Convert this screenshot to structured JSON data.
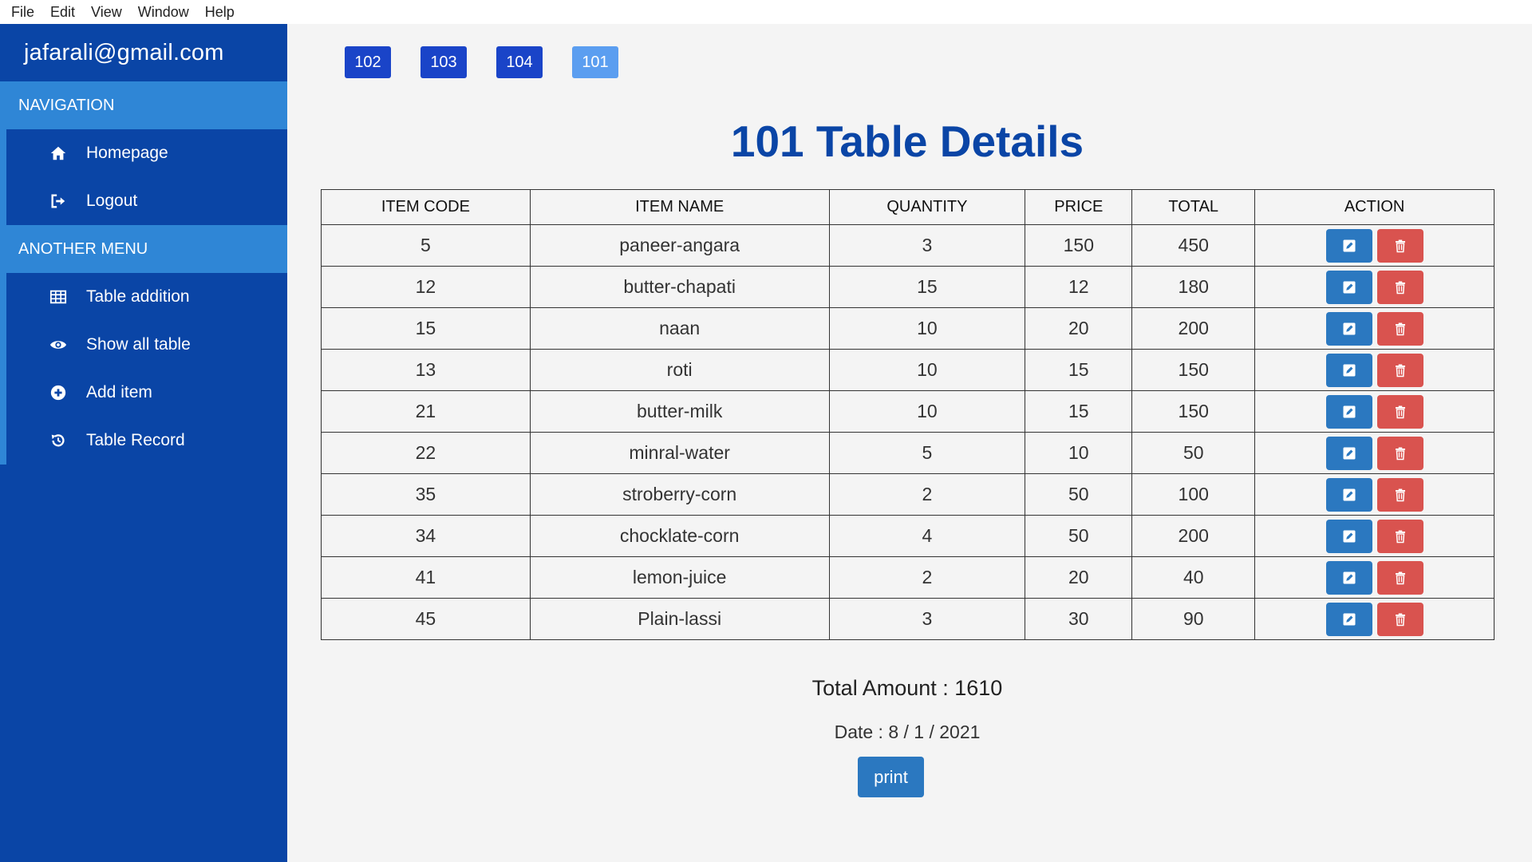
{
  "menubar": {
    "items": [
      "File",
      "Edit",
      "View",
      "Window",
      "Help"
    ]
  },
  "sidebar": {
    "email": "jafarali@gmail.com",
    "navigation": {
      "title": "NAVIGATION",
      "items": [
        {
          "label": "Homepage",
          "icon": "home-icon"
        },
        {
          "label": "Logout",
          "icon": "logout-icon"
        }
      ]
    },
    "another_menu": {
      "title": "ANOTHER MENU",
      "items": [
        {
          "label": "Table addition",
          "icon": "table-icon"
        },
        {
          "label": "Show all table",
          "icon": "eye-icon"
        },
        {
          "label": "Add item",
          "icon": "plus-circle-icon"
        },
        {
          "label": "Table Record",
          "icon": "history-icon"
        }
      ]
    }
  },
  "tabs": [
    "102",
    "103",
    "104",
    "101"
  ],
  "active_tab": "101",
  "title": "101 Table Details",
  "table": {
    "headers": [
      "ITEM CODE",
      "ITEM NAME",
      "QUANTITY",
      "PRICE",
      "TOTAL",
      "ACTION"
    ],
    "rows": [
      [
        "5",
        "paneer-angara",
        "3",
        "150",
        "450"
      ],
      [
        "12",
        "butter-chapati",
        "15",
        "12",
        "180"
      ],
      [
        "15",
        "naan",
        "10",
        "20",
        "200"
      ],
      [
        "13",
        "roti",
        "10",
        "15",
        "150"
      ],
      [
        "21",
        "butter-milk",
        "10",
        "15",
        "150"
      ],
      [
        "22",
        "minral-water",
        "5",
        "10",
        "50"
      ],
      [
        "35",
        "stroberry-corn",
        "2",
        "50",
        "100"
      ],
      [
        "34",
        "chocklate-corn",
        "4",
        "50",
        "200"
      ],
      [
        "41",
        "lemon-juice",
        "2",
        "20",
        "40"
      ],
      [
        "45",
        "Plain-lassi",
        "3",
        "30",
        "90"
      ]
    ]
  },
  "total_amount": "Total Amount : 1610",
  "date": "Date : 8 / 1 / 2021",
  "print_label": "print",
  "colors": {
    "sidebar": "#0a45a6",
    "section": "#2f86d6",
    "tab_dark": "#1a44c8",
    "tab_active": "#5b9ef0",
    "edit": "#2b78c0",
    "delete": "#d9534f",
    "title": "#0a45a6"
  }
}
